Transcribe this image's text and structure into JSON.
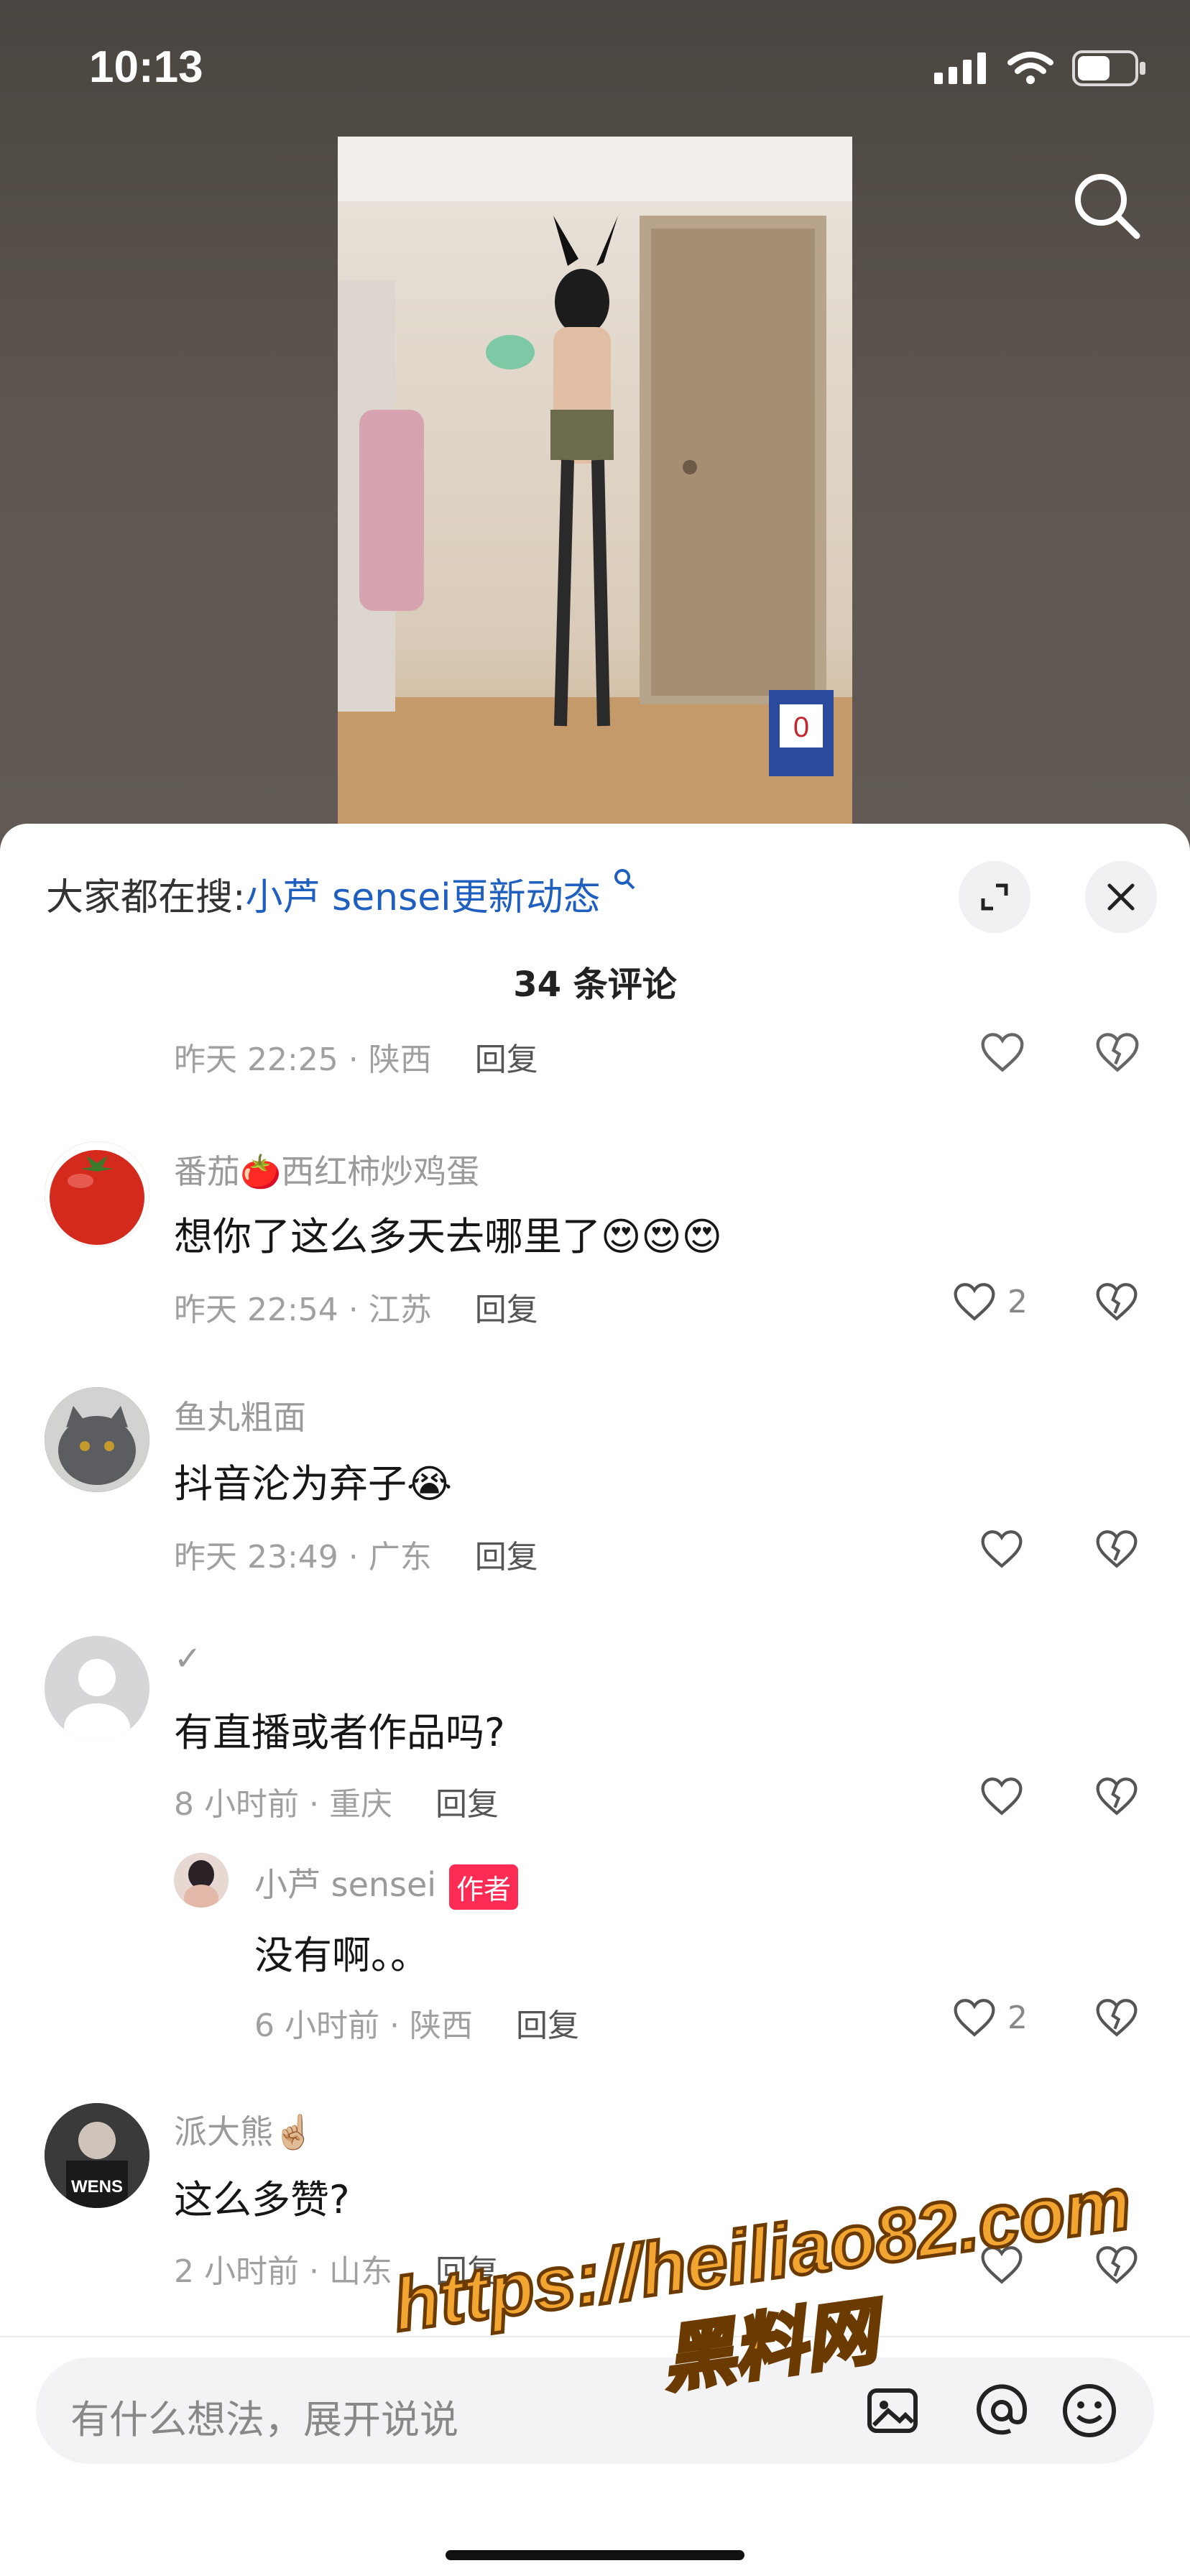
{
  "status_bar": {
    "time": "10:13"
  },
  "video": {
    "card_text": "0"
  },
  "sheet": {
    "trend_prefix": "大家都在搜:",
    "trend_query": "小芦 sensei更新动态",
    "comment_count": "34 条评论"
  },
  "partial_row": {
    "meta": "昨天 22:25 · 陕西",
    "reply": "回复"
  },
  "comments": [
    {
      "username": "番茄🍅西红柿炒鸡蛋",
      "text": "想你了这么多天去哪里了😍😍😍",
      "time_loc": "昨天 22:54 · 江苏",
      "reply": "回复",
      "likes": "2",
      "avatar": "tomato-avatar"
    },
    {
      "username": "鱼丸粗面",
      "text": "抖音沦为弃子😭",
      "time_loc": "昨天 23:49 · 广东",
      "reply": "回复",
      "likes": "",
      "avatar": "cat-avatar"
    },
    {
      "username": "✓",
      "text": "有直播或者作品吗?",
      "time_loc": "8 小时前 · 重庆",
      "reply": "回复",
      "likes": "",
      "avatar": "default-avatar",
      "sub_reply": {
        "username": "小芦 sensei",
        "tag": "作者",
        "text": "没有啊。。",
        "time_loc": "6 小时前 · 陕西",
        "reply": "回复",
        "likes": "2"
      }
    },
    {
      "username": "派大熊☝🏼",
      "text": "这么多赞?",
      "time_loc": "2 小时前 · 山东",
      "reply": "回复",
      "likes": "",
      "avatar": "photo-avatar"
    }
  ],
  "input_bar": {
    "placeholder": "有什么想法，展开说说"
  },
  "watermark": {
    "line1": "https://heiliao82.com",
    "line2": "黑料网"
  },
  "colors": {
    "accent_link": "#1f5fbf",
    "author_tag": "#fe2c55",
    "watermark": "#f2a531"
  }
}
